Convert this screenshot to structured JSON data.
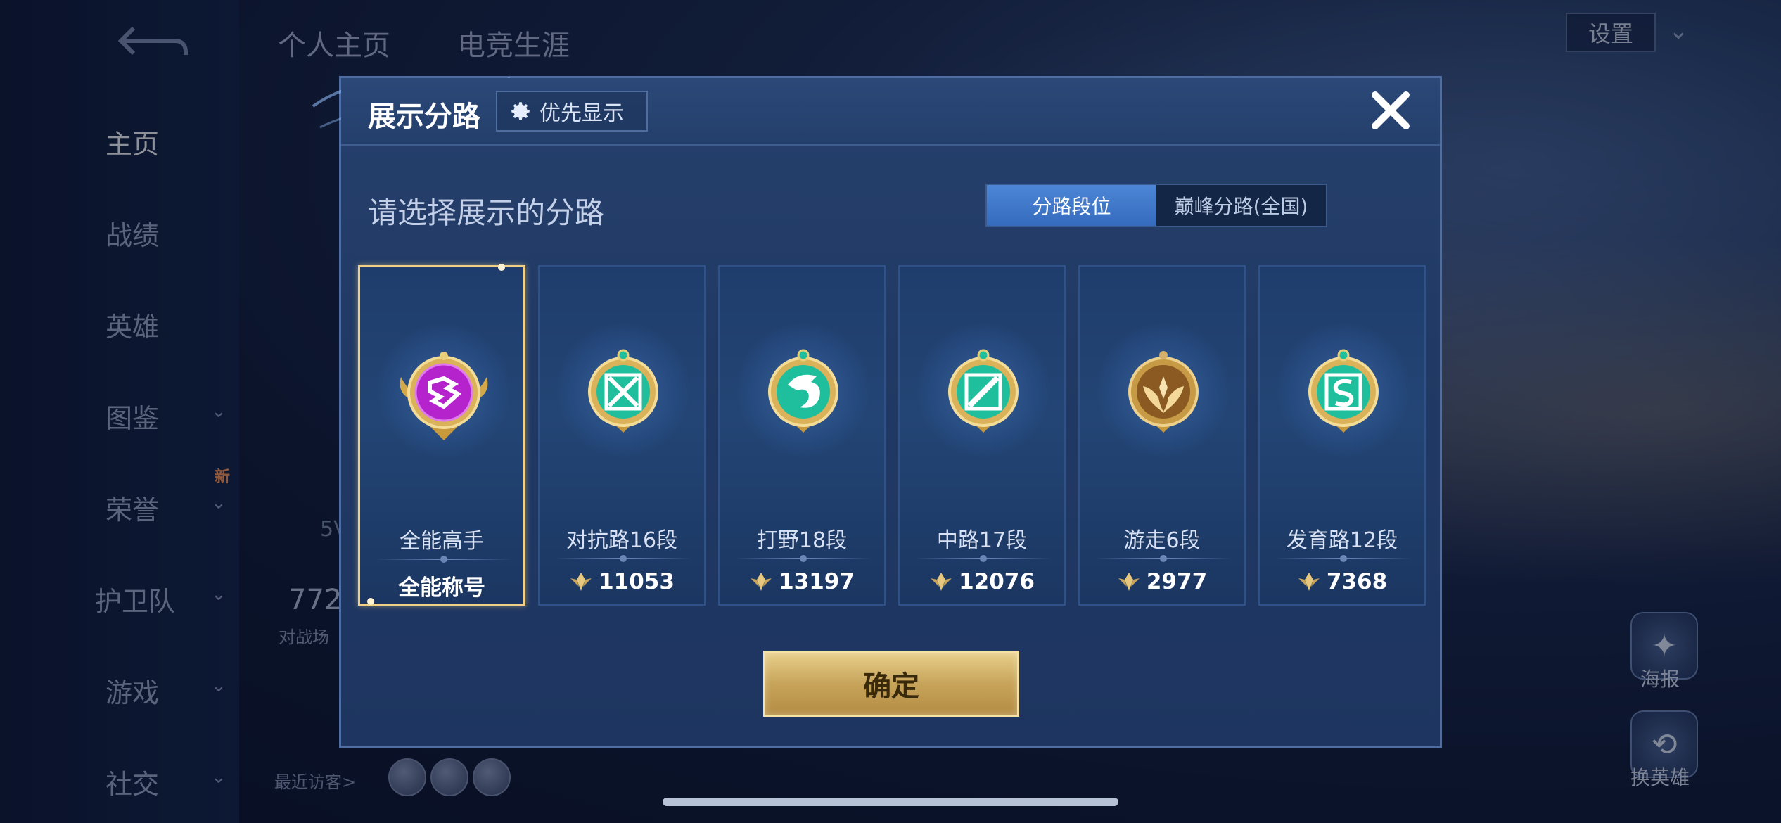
{
  "background": {
    "top_tabs": [
      "个人主页",
      "电竞生涯"
    ],
    "settings_label": "设置",
    "sidebar": [
      {
        "label": "主页",
        "active": true,
        "chevron": false
      },
      {
        "label": "战绩",
        "active": false,
        "chevron": false
      },
      {
        "label": "英雄",
        "active": false,
        "chevron": false
      },
      {
        "label": "图鉴",
        "active": false,
        "chevron": true
      },
      {
        "label": "荣誉",
        "active": false,
        "chevron": true
      },
      {
        "label": "护卫队",
        "active": false,
        "chevron": true
      },
      {
        "label": "游戏",
        "active": false,
        "chevron": true
      },
      {
        "label": "社交",
        "active": false,
        "chevron": true
      }
    ],
    "new_badge": "新",
    "stat_number": "772",
    "stat_label": "对战场",
    "stat_small": "5V",
    "visitors_label": "最近访客>",
    "right_buttons": [
      "海报",
      "换英雄"
    ]
  },
  "modal": {
    "title": "展示分路",
    "priority_label": "优先显示",
    "prompt": "请选择展示的分路",
    "tabs": [
      {
        "label": "分路段位",
        "active": true
      },
      {
        "label": "巅峰分路(全国)",
        "active": false
      }
    ],
    "cards": [
      {
        "name": "全能高手",
        "score": "全能称号",
        "emblem": "allround-emblem-icon",
        "selected": true
      },
      {
        "name": "对抗路16段",
        "score": "11053",
        "emblem": "clash-lane-emblem-icon",
        "selected": false
      },
      {
        "name": "打野18段",
        "score": "13197",
        "emblem": "jungle-emblem-icon",
        "selected": false
      },
      {
        "name": "中路17段",
        "score": "12076",
        "emblem": "mid-lane-emblem-icon",
        "selected": false
      },
      {
        "name": "游走6段",
        "score": "2977",
        "emblem": "roam-emblem-icon",
        "selected": false
      },
      {
        "name": "发育路12段",
        "score": "7368",
        "emblem": "farm-lane-emblem-icon",
        "selected": false
      }
    ],
    "confirm_label": "确定"
  },
  "colors": {
    "gold": "#f0cf86",
    "tab_active": "#4d86d6",
    "emblem_teal": "#1fbf9e",
    "emblem_purple": "#c63ad9"
  }
}
